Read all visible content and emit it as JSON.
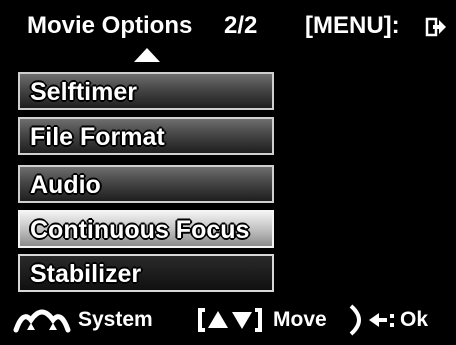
{
  "header": {
    "title": "Movie Options",
    "page_indicator": "2/2",
    "menu_hint": "[MENU]:"
  },
  "menu": {
    "items": [
      {
        "label": "Selftimer"
      },
      {
        "label": "File Format"
      },
      {
        "label": "Audio"
      },
      {
        "label": "Continuous Focus",
        "selected": true
      },
      {
        "label": "Stabilizer"
      }
    ]
  },
  "footer": {
    "system_label": "System",
    "move_label": "Move",
    "ok_label": "Ok"
  },
  "icons": [
    "exit-icon",
    "up-arrow-icon",
    "system-wave-icon",
    "up-down-arrows-icon",
    "ok-dial-icon"
  ],
  "colors": {
    "background": "#000000",
    "text": "#ffffff",
    "item_border": "#cfcfcf",
    "selected_fill": "#bdbdbd"
  }
}
